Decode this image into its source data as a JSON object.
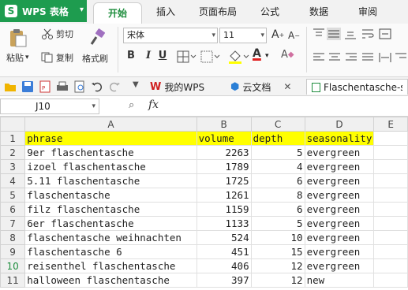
{
  "app": {
    "title": "WPS 表格"
  },
  "menu": {
    "tabs": [
      "开始",
      "插入",
      "页面布局",
      "公式",
      "数据",
      "审阅"
    ],
    "active_tab": "开始"
  },
  "ribbon": {
    "paste": "粘贴",
    "cut": "剪切",
    "copy": "复制",
    "format_painter": "格式刷",
    "font_name": "宋体",
    "font_size": "11",
    "bold": "B",
    "italic": "I",
    "underline": "U",
    "grow": "A",
    "shrink": "A",
    "font_color_letter": "A",
    "clear_letter": "A"
  },
  "quick_bar": {
    "tabs": [
      {
        "label": "我的WPS",
        "icon": "wps-icon"
      },
      {
        "label": "云文档",
        "icon": "cloud-doc-icon"
      },
      {
        "label": "Flaschentasche-so",
        "icon": "spreadsheet-icon"
      }
    ]
  },
  "formula_bar": {
    "cell_ref": "J10",
    "fx": "fx",
    "content": ""
  },
  "sheet": {
    "columns": [
      "A",
      "B",
      "C",
      "D",
      "E"
    ],
    "rows": [
      {
        "n": "1",
        "phrase": "phrase",
        "volume": "volume",
        "depth": "depth",
        "seasonality": "seasonality"
      },
      {
        "n": "2",
        "phrase": "9er flaschentasche",
        "volume": "2263",
        "depth": "5",
        "seasonality": "evergreen"
      },
      {
        "n": "3",
        "phrase": "izoel flaschentasche",
        "volume": "1789",
        "depth": "4",
        "seasonality": "evergreen"
      },
      {
        "n": "4",
        "phrase": "5.11 flaschentasche",
        "volume": "1725",
        "depth": "6",
        "seasonality": "evergreen"
      },
      {
        "n": "5",
        "phrase": "flaschentasche",
        "volume": "1261",
        "depth": "8",
        "seasonality": "evergreen"
      },
      {
        "n": "6",
        "phrase": "filz flaschentasche",
        "volume": "1159",
        "depth": "6",
        "seasonality": "evergreen"
      },
      {
        "n": "7",
        "phrase": "6er flaschentasche",
        "volume": "1133",
        "depth": "5",
        "seasonality": "evergreen"
      },
      {
        "n": "8",
        "phrase": "flaschentasche weihnachten",
        "volume": "524",
        "depth": "10",
        "seasonality": "evergreen"
      },
      {
        "n": "9",
        "phrase": "flaschentasche 6",
        "volume": "451",
        "depth": "15",
        "seasonality": "evergreen"
      },
      {
        "n": "10",
        "phrase": "reisenthel flaschentasche",
        "volume": "406",
        "depth": "12",
        "seasonality": "evergreen"
      },
      {
        "n": "11",
        "phrase": "halloween flaschentasche",
        "volume": "397",
        "depth": "12",
        "seasonality": "new"
      }
    ],
    "header_highlight": "#ffff00"
  }
}
